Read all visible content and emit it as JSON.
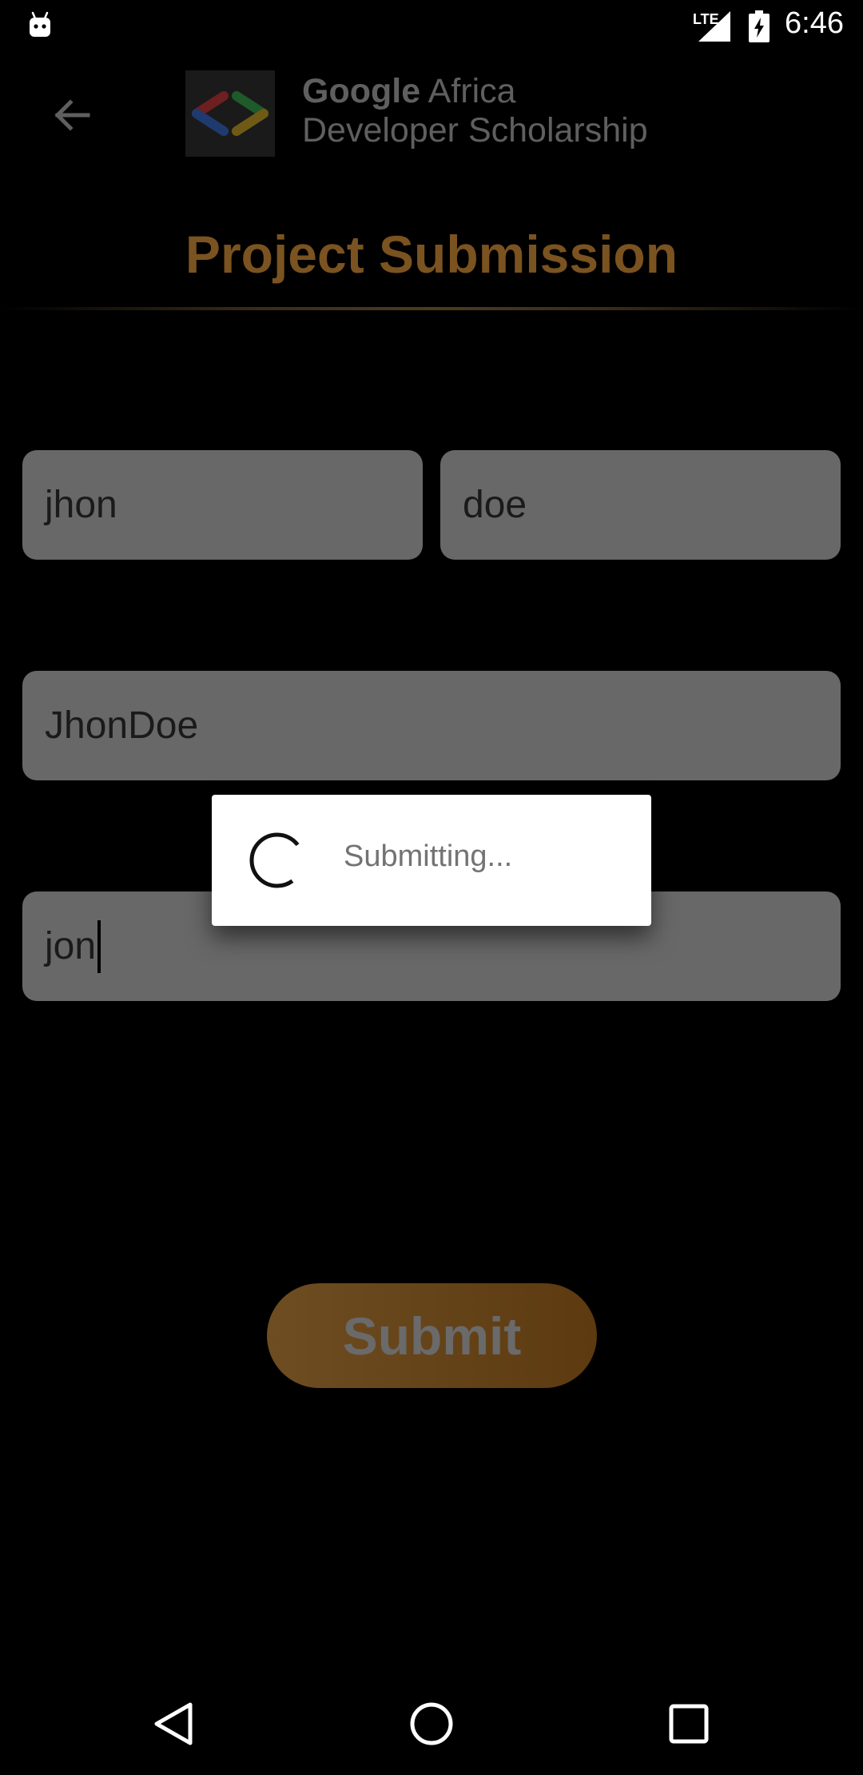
{
  "status_bar": {
    "time": "6:46",
    "network": "LTE"
  },
  "header": {
    "logo_line1_bold": "Google",
    "logo_line1_rest": " Africa",
    "logo_line2": "Developer Scholarship",
    "back_icon": "arrow-back-icon"
  },
  "page": {
    "title": "Project Submission"
  },
  "form": {
    "first_name": "jhon",
    "last_name": "doe",
    "email": "JhonDoe",
    "github_link": "jon"
  },
  "submit": {
    "label": "Submit"
  },
  "dialog": {
    "message": "Submitting..."
  },
  "colors": {
    "title": "#7a5320",
    "input_bg": "#686868",
    "button_start": "#6e4d23",
    "button_end": "#5d3a0f",
    "background": "#000000"
  }
}
